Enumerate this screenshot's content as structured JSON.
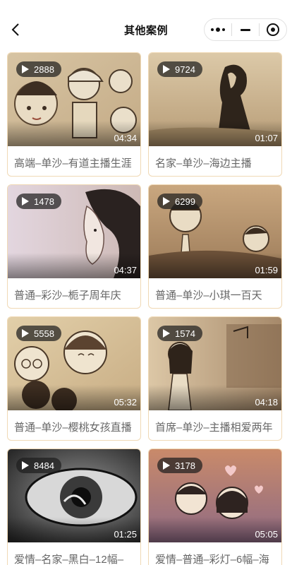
{
  "nav": {
    "title": "其他案例",
    "back_icon": "chevron-left-icon",
    "capsule": [
      "more-dots-icon",
      "minimize-icon",
      "close-target-icon"
    ]
  },
  "colors": {
    "card_border": "#f0d9b5",
    "title_text": "#666666",
    "badge_bg": "#1e1e1e"
  },
  "cases": [
    {
      "views": "2888",
      "duration": "04:34",
      "title": "高端–单沙–有道主播生涯"
    },
    {
      "views": "9724",
      "duration": "01:07",
      "title": "名家–单沙–海边主播"
    },
    {
      "views": "1478",
      "duration": "04:37",
      "title": "普通–彩沙–栀子周年庆"
    },
    {
      "views": "6299",
      "duration": "01:59",
      "title": "普通–单沙–小琪一百天"
    },
    {
      "views": "5558",
      "duration": "05:32",
      "title": "普通–单沙–樱桃女孩直播"
    },
    {
      "views": "1574",
      "duration": "04:18",
      "title": "首席–单沙–主播相爱两年"
    },
    {
      "views": "8484",
      "duration": "01:25",
      "title": "爱情–名家–黑白–12幅–"
    },
    {
      "views": "3178",
      "duration": "05:05",
      "title": "爱情–普通–彩灯–6幅–海"
    }
  ]
}
